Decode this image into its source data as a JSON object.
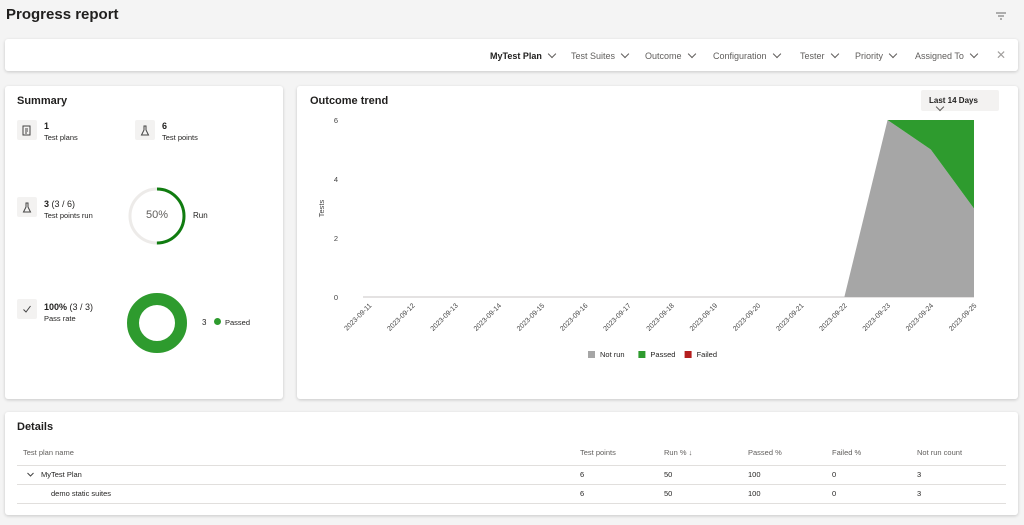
{
  "page": {
    "title": "Progress report"
  },
  "filters": [
    {
      "label": "MyTest Plan",
      "active": true
    },
    {
      "label": "Test Suites"
    },
    {
      "label": "Outcome"
    },
    {
      "label": "Configuration"
    },
    {
      "label": "Tester"
    },
    {
      "label": "Priority"
    },
    {
      "label": "Assigned To"
    }
  ],
  "summary": {
    "title": "Summary",
    "test_plans": {
      "value": "1",
      "label": "Test plans"
    },
    "test_points": {
      "value": "6",
      "label": "Test points"
    },
    "points_run": {
      "value": "3",
      "detail": "(3 / 6)",
      "label": "Test points run",
      "ring_label": "50%",
      "ring_text": "Run",
      "fraction": 0.5
    },
    "pass_rate": {
      "value": "100%",
      "detail": "(3 / 3)",
      "label": "Pass rate",
      "legend_count": "3",
      "legend_label": "Passed",
      "fraction": 1.0
    }
  },
  "trend": {
    "title": "Outcome trend",
    "range_label": "Last 14 Days"
  },
  "chart_data": {
    "type": "area",
    "ylabel": "Tests",
    "ylim": [
      0,
      6
    ],
    "yticks": [
      "0",
      "2",
      "4",
      "6"
    ],
    "x": [
      "2023-09-11",
      "2023-09-12",
      "2023-09-13",
      "2023-09-14",
      "2023-09-15",
      "2023-09-16",
      "2023-09-17",
      "2023-09-18",
      "2023-09-19",
      "2023-09-20",
      "2023-09-21",
      "2023-09-22",
      "2023-09-23",
      "2023-09-24",
      "2023-09-25"
    ],
    "series": [
      {
        "name": "Not run",
        "color": "#a6a6a6",
        "values": [
          0,
          0,
          0,
          0,
          0,
          0,
          0,
          0,
          0,
          0,
          0,
          0,
          6,
          5,
          3
        ]
      },
      {
        "name": "Passed",
        "color": "#2e9b2e",
        "values": [
          0,
          0,
          0,
          0,
          0,
          0,
          0,
          0,
          0,
          0,
          0,
          0,
          0,
          1,
          3
        ]
      },
      {
        "name": "Failed",
        "color": "#b41e1e",
        "values": [
          0,
          0,
          0,
          0,
          0,
          0,
          0,
          0,
          0,
          0,
          0,
          0,
          0,
          0,
          0
        ]
      }
    ],
    "stacked": true,
    "legend": "bottom"
  },
  "details": {
    "title": "Details",
    "columns": [
      "Test plan name",
      "Test points",
      "Run % ↓",
      "Passed %",
      "Failed %",
      "Not run count"
    ],
    "rows": [
      {
        "name": "MyTest Plan",
        "points": "6",
        "run": "50",
        "passed": "100",
        "failed": "0",
        "notrun": "3"
      },
      {
        "name": "demo static suites",
        "points": "6",
        "run": "50",
        "passed": "100",
        "failed": "0",
        "notrun": "3"
      }
    ]
  }
}
